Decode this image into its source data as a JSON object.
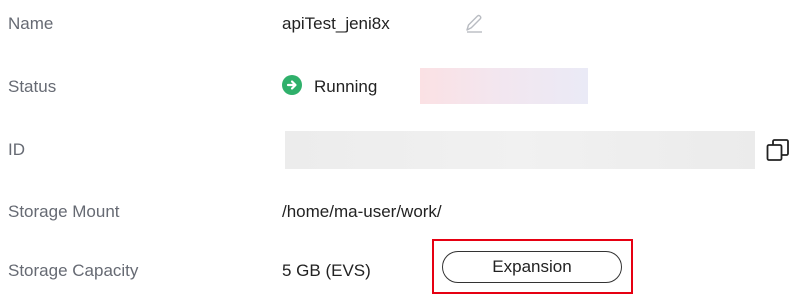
{
  "fields": {
    "name": {
      "label": "Name",
      "value": "apiTest_jeni8x",
      "action_icon": "edit-icon"
    },
    "status": {
      "label": "Status",
      "value": "Running",
      "status_icon": "arrow-right-circle-icon",
      "status_color": "#2fb06b"
    },
    "id": {
      "label": "ID",
      "action_icon": "copy-icon"
    },
    "storage_mount": {
      "label": "Storage Mount",
      "value": "/home/ma-user/work/"
    },
    "storage_capacity": {
      "label": "Storage Capacity",
      "value": "5 GB (EVS)"
    }
  },
  "actions": {
    "expansion_label": "Expansion",
    "highlight_color": "#e60012"
  }
}
